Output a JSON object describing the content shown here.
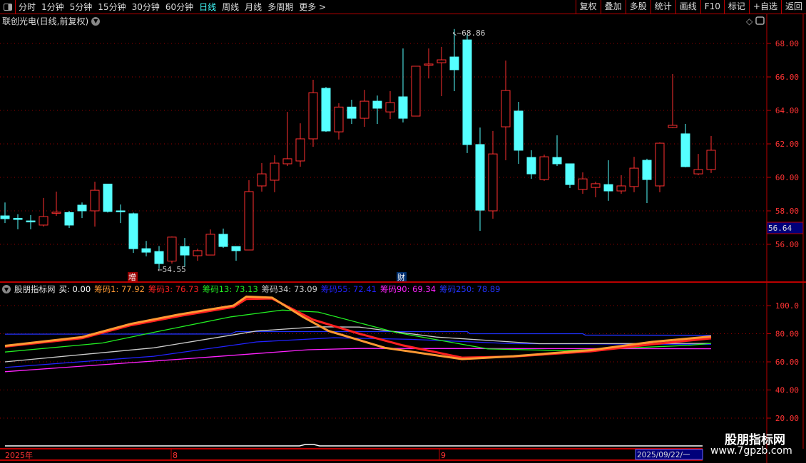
{
  "toolbar": {
    "periods": [
      "分时",
      "1分钟",
      "5分钟",
      "15分钟",
      "30分钟",
      "60分钟",
      "日线",
      "周线",
      "月线",
      "多周期",
      "更多 >"
    ],
    "active": "日线",
    "buttons": [
      "复权",
      "叠加",
      "多股",
      "统计",
      "画线",
      "F10",
      "标记",
      "+自选",
      "返回"
    ]
  },
  "title": "联创光电(日线,前复权)",
  "price_axis": {
    "ticks": [
      "68.00",
      "66.00",
      "64.00",
      "62.00",
      "60.00",
      "58.00",
      "56.00"
    ],
    "current": "56.64",
    "high_label": "68.86",
    "low_label": "54.55"
  },
  "markers": {
    "zeng": "增",
    "cai": "财"
  },
  "indicator": {
    "name": "股朋指标网",
    "buy": "买: 0.00",
    "legend": [
      {
        "label": "筹码1: 77.92",
        "color": "#ff9933"
      },
      {
        "label": "筹码3: 76.73",
        "color": "#ff2020"
      },
      {
        "label": "筹码13: 73.13",
        "color": "#22ee22"
      },
      {
        "label": "筹码34: 73.09",
        "color": "#cccccc"
      },
      {
        "label": "筹码55: 72.41",
        "color": "#2222ff"
      },
      {
        "label": "筹码90: 69.34",
        "color": "#ff22ff"
      },
      {
        "label": "筹码250: 78.89",
        "color": "#2233ff"
      }
    ],
    "ticks": [
      "100.0",
      "80.00",
      "60.00",
      "40.00",
      "20.00"
    ]
  },
  "dates": {
    "year": "2025年",
    "m8": "8",
    "m9": "9",
    "current": "2025/09/22/一"
  },
  "watermark": {
    "name": "股朋指标网",
    "url": "www.7gpzb.com"
  },
  "chart_data": {
    "type": "candlestick",
    "ohlc": [
      [
        57.7,
        58.5,
        57.27,
        57.53
      ],
      [
        57.55,
        57.8,
        56.9,
        57.5
      ],
      [
        57.4,
        57.75,
        56.9,
        57.38
      ],
      [
        57.15,
        58.77,
        57.06,
        57.66
      ],
      [
        57.87,
        59.15,
        57.7,
        57.92
      ],
      [
        57.9,
        58.0,
        56.98,
        57.15
      ],
      [
        58.34,
        58.5,
        57.57,
        58.0
      ],
      [
        58.0,
        59.74,
        57.06,
        59.23
      ],
      [
        59.6,
        59.6,
        57.9,
        57.96
      ],
      [
        58.0,
        58.38,
        57.27,
        57.98
      ],
      [
        57.83,
        57.9,
        55.49,
        55.74
      ],
      [
        55.74,
        56.2,
        55.28,
        55.53
      ],
      [
        55.57,
        55.9,
        54.55,
        54.85
      ],
      [
        55.0,
        56.47,
        54.85,
        56.43
      ],
      [
        55.87,
        56.38,
        54.68,
        55.36
      ],
      [
        55.32,
        55.74,
        55.02,
        55.62
      ],
      [
        55.36,
        56.89,
        55.36,
        56.6
      ],
      [
        56.6,
        56.94,
        55.78,
        55.87
      ],
      [
        55.87,
        55.87,
        55.02,
        55.62
      ],
      [
        55.66,
        59.83,
        55.66,
        59.15
      ],
      [
        59.49,
        60.85,
        59.15,
        60.21
      ],
      [
        59.83,
        61.32,
        59.11,
        60.85
      ],
      [
        60.81,
        63.91,
        60.68,
        61.11
      ],
      [
        60.98,
        63.23,
        60.64,
        62.3
      ],
      [
        62.3,
        65.83,
        61.83,
        65.06
      ],
      [
        65.32,
        65.4,
        62.72,
        62.77
      ],
      [
        62.72,
        64.43,
        62.26,
        64.2
      ],
      [
        64.2,
        64.64,
        63.19,
        63.53
      ],
      [
        63.53,
        65.23,
        63.02,
        64.55
      ],
      [
        64.55,
        64.89,
        63.19,
        64.13
      ],
      [
        63.91,
        65.15,
        63.49,
        64.47
      ],
      [
        64.81,
        67.7,
        63.28,
        63.53
      ],
      [
        63.66,
        66.64,
        63.66,
        66.64
      ],
      [
        66.72,
        67.7,
        65.91,
        66.77
      ],
      [
        66.85,
        67.79,
        64.85,
        67.02
      ],
      [
        67.19,
        68.86,
        65.15,
        66.43
      ],
      [
        68.21,
        68.55,
        61.45,
        61.96
      ],
      [
        61.96,
        62.98,
        56.81,
        58.04
      ],
      [
        58.0,
        62.77,
        57.53,
        61.4
      ],
      [
        63.02,
        66.98,
        61.02,
        65.19
      ],
      [
        63.96,
        64.51,
        60.81,
        61.62
      ],
      [
        61.19,
        61.62,
        59.91,
        60.21
      ],
      [
        59.87,
        61.36,
        59.79,
        61.23
      ],
      [
        61.19,
        62.51,
        60.68,
        60.81
      ],
      [
        60.81,
        60.81,
        59.36,
        59.57
      ],
      [
        59.28,
        60.3,
        59.02,
        59.91
      ],
      [
        59.4,
        59.74,
        58.81,
        59.62
      ],
      [
        59.57,
        61.02,
        58.6,
        59.19
      ],
      [
        59.19,
        60.13,
        59.02,
        59.49
      ],
      [
        59.45,
        61.23,
        59.11,
        60.55
      ],
      [
        61.02,
        61.11,
        58.47,
        59.87
      ],
      [
        59.49,
        62.09,
        59.11,
        62.04
      ],
      [
        62.98,
        66.17,
        62.94,
        63.11
      ],
      [
        62.6,
        63.19,
        60.6,
        60.64
      ],
      [
        60.21,
        61.4,
        60.13,
        60.47
      ],
      [
        60.47,
        62.47,
        60.26,
        61.62
      ]
    ],
    "price_range": [
      54,
      69
    ],
    "indicator_range": [
      10,
      110
    ],
    "series": [
      {
        "name": "筹码1",
        "color": "#ff9933",
        "points": [
          [
            0,
            71.4
          ],
          [
            6,
            77.6
          ],
          [
            9.8,
            87
          ],
          [
            13.6,
            93.7
          ],
          [
            17.8,
            100
          ],
          [
            18.8,
            106.4
          ],
          [
            20.8,
            105.6
          ],
          [
            23.2,
            92
          ],
          [
            25.2,
            82
          ],
          [
            29.6,
            70
          ],
          [
            35.6,
            62
          ],
          [
            39.6,
            64
          ],
          [
            45.6,
            68.3
          ],
          [
            50.4,
            74.2
          ],
          [
            55,
            78
          ]
        ]
      },
      {
        "name": "筹码3",
        "color": "#ff2020",
        "points": [
          [
            0,
            70.9
          ],
          [
            6,
            76.8
          ],
          [
            9.8,
            86
          ],
          [
            13.6,
            92.6
          ],
          [
            17.8,
            99
          ],
          [
            18.8,
            104.7
          ],
          [
            20.8,
            105
          ],
          [
            24,
            90
          ],
          [
            27.6,
            80
          ],
          [
            31,
            71.7
          ],
          [
            35.6,
            63
          ],
          [
            39.6,
            63.8
          ],
          [
            45.6,
            67.5
          ],
          [
            50.4,
            72.5
          ],
          [
            55,
            76.7
          ]
        ]
      },
      {
        "name": "筹码13",
        "color": "#22ee22",
        "points": [
          [
            0,
            67
          ],
          [
            7.6,
            73.4
          ],
          [
            11.6,
            81
          ],
          [
            17.6,
            92
          ],
          [
            21.6,
            96.8
          ],
          [
            24.4,
            95.4
          ],
          [
            30.4,
            81
          ],
          [
            37.6,
            69.2
          ],
          [
            43.6,
            68
          ],
          [
            49.6,
            70.3
          ],
          [
            53.2,
            71.7
          ],
          [
            55,
            73.1
          ]
        ]
      },
      {
        "name": "筹码34",
        "color": "#cccccc",
        "points": [
          [
            0,
            60
          ],
          [
            11.6,
            70
          ],
          [
            19.6,
            81.9
          ],
          [
            24.4,
            84.9
          ],
          [
            27.6,
            84.7
          ],
          [
            33.6,
            77.6
          ],
          [
            41.6,
            72.9
          ],
          [
            55,
            73.1
          ]
        ]
      },
      {
        "name": "筹码55",
        "color": "#2222ff",
        "points": [
          [
            0,
            56
          ],
          [
            11.6,
            64
          ],
          [
            19.6,
            74.2
          ],
          [
            25.6,
            77.1
          ],
          [
            31.6,
            76
          ],
          [
            39.6,
            72.9
          ],
          [
            55,
            72.4
          ]
        ]
      },
      {
        "name": "筹码90",
        "color": "#ff22ff",
        "points": [
          [
            0,
            53
          ],
          [
            15.6,
            63.2
          ],
          [
            23.6,
            68.6
          ],
          [
            27.6,
            69.5
          ],
          [
            55,
            69.3
          ]
        ]
      },
      {
        "name": "筹码250",
        "color": "#2233ff",
        "points": [
          [
            0,
            79.7
          ],
          [
            17.6,
            79.8
          ],
          [
            18,
            81.5
          ],
          [
            36,
            81.5
          ],
          [
            36.2,
            80
          ],
          [
            45,
            80
          ],
          [
            45.2,
            79
          ],
          [
            55,
            78.9
          ]
        ]
      }
    ]
  }
}
